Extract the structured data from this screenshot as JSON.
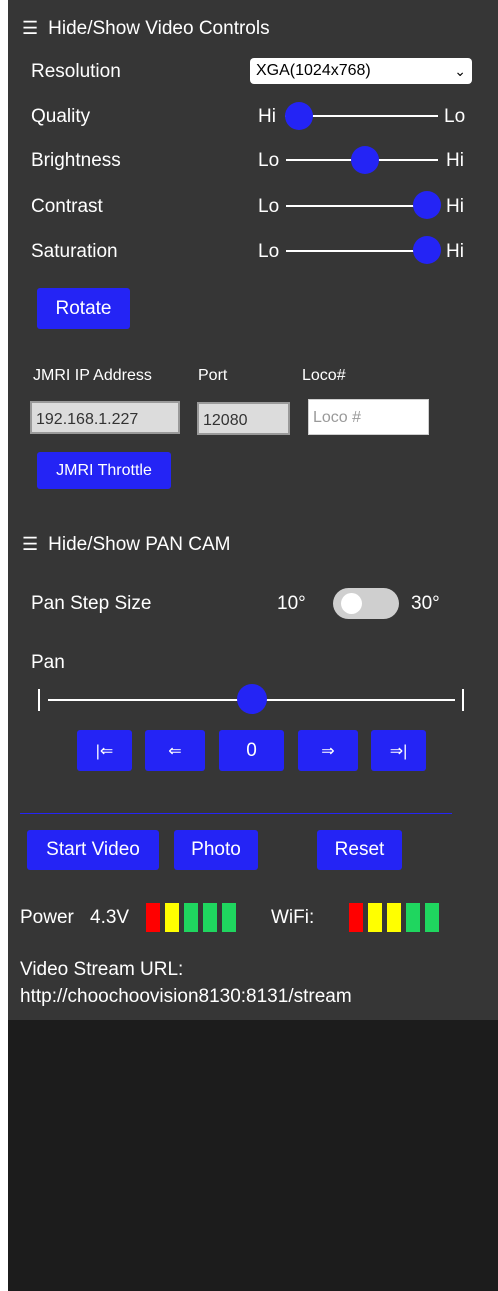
{
  "video_controls": {
    "header": "Hide/Show Video Controls",
    "resolution": {
      "label": "Resolution",
      "value": "XGA(1024x768)"
    },
    "quality": {
      "label": "Quality",
      "min_label": "Hi",
      "max_label": "Lo",
      "value_fraction": 0.0
    },
    "brightness": {
      "label": "Brightness",
      "min_label": "Lo",
      "max_label": "Hi",
      "value_fraction": 0.5
    },
    "contrast": {
      "label": "Contrast",
      "min_label": "Lo",
      "max_label": "Hi",
      "value_fraction": 1.0
    },
    "saturation": {
      "label": "Saturation",
      "min_label": "Lo",
      "max_label": "Hi",
      "value_fraction": 1.0
    },
    "rotate_label": "Rotate"
  },
  "jmri": {
    "ip_label": "JMRI IP Address",
    "ip_value": "192.168.1.227",
    "port_label": "Port",
    "port_value": "12080",
    "loco_label": "Loco#",
    "loco_placeholder": "Loco #",
    "throttle_label": "JMRI Throttle"
  },
  "pan_cam": {
    "header": "Hide/Show PAN CAM",
    "step_label": "Pan Step Size",
    "step_low": "10°",
    "step_high": "30°",
    "step_toggle_on": false,
    "pan_label": "Pan",
    "pan_value_fraction": 0.5,
    "buttons": [
      "|⇐",
      "⇐",
      "0",
      "⇒",
      "⇒|"
    ]
  },
  "actions": {
    "start_video": "Start Video",
    "photo": "Photo",
    "reset": "Reset"
  },
  "status": {
    "power_label": "Power",
    "power_value": "4.3V",
    "power_bars": [
      "red",
      "yellow",
      "green",
      "green",
      "green"
    ],
    "wifi_label": "WiFi:",
    "wifi_bars": [
      "red",
      "yellow",
      "yellow",
      "green",
      "green"
    ],
    "stream_label": "Video Stream URL:",
    "stream_url": "http://choochoovision8130:8131/stream"
  },
  "colors": {
    "accent": "#2424f5",
    "panel": "#363636",
    "red": "#ff0000",
    "yellow": "#ffff00",
    "green": "#1fd65f"
  }
}
